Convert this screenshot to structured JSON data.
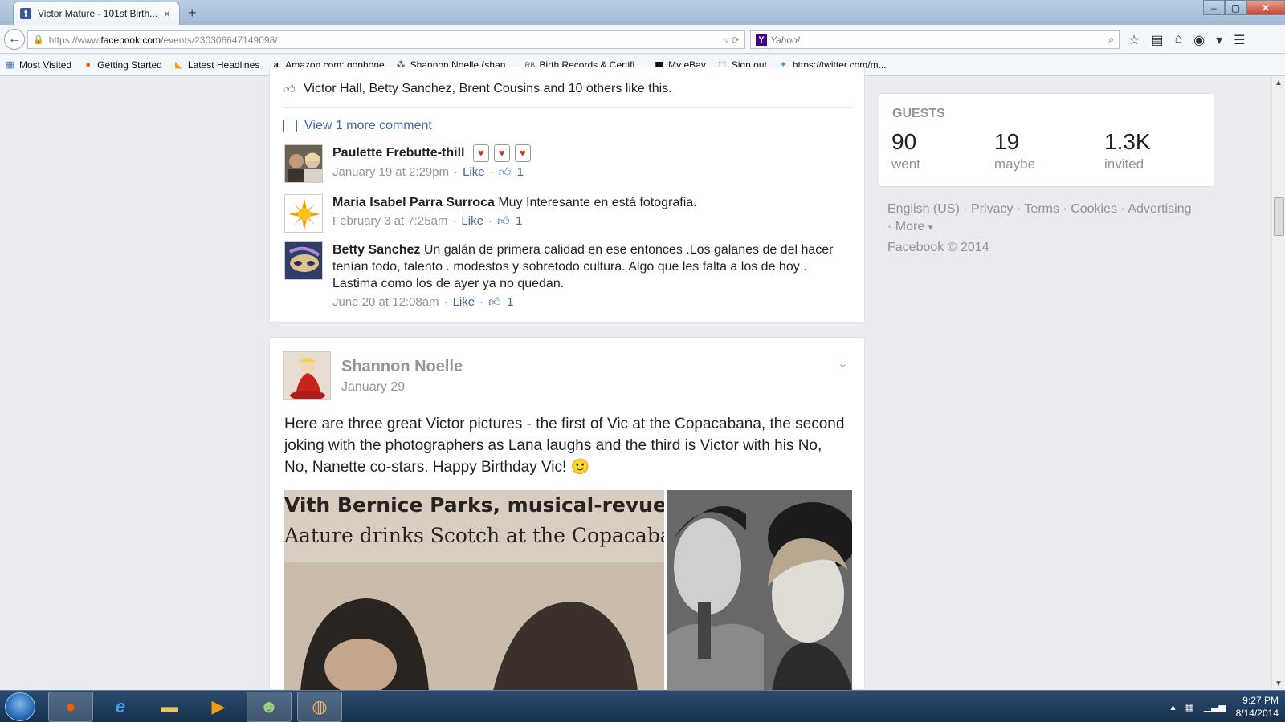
{
  "browser": {
    "tab_title": "Victor Mature - 101st Birth...",
    "tab_close": "×",
    "new_tab": "+",
    "url_prefix": "https://www.",
    "url_domain": "facebook.com",
    "url_path": "/events/230306647149098/",
    "search_placeholder": "Yahoo!",
    "window_min": "–",
    "window_max": "▢",
    "window_close": "✕"
  },
  "bookmarks": [
    {
      "label": "Most Visited",
      "icon": "most-visited-icon"
    },
    {
      "label": "Getting Started",
      "icon": "firefox-icon"
    },
    {
      "label": "Latest Headlines",
      "icon": "rss-icon"
    },
    {
      "label": "Amazon.com: gophone",
      "icon": "amazon-icon"
    },
    {
      "label": "Shannon Noelle (shan...",
      "icon": "people-icon"
    },
    {
      "label": "Birth Records & Certifi...",
      "icon": "rb-icon"
    },
    {
      "label": "My eBay",
      "icon": "ebay-icon"
    },
    {
      "label": "Sign out",
      "icon": "page-icon"
    },
    {
      "label": "https://twitter.com/m...",
      "icon": "twitter-icon"
    }
  ],
  "post1": {
    "likes_text": "Victor Hall, Betty Sanchez, Brent Cousins and 10 others like this.",
    "view_more": "View 1 more comment",
    "comments": [
      {
        "name": "Paulette Frebutte-thill",
        "text": "",
        "date": "January 19 at 2:29pm",
        "like": "Like",
        "likes": "1"
      },
      {
        "name": "Maria Isabel Parra Surroca",
        "text": "Muy Interesante en está fotografia.",
        "date": "February 3 at 7:25am",
        "like": "Like",
        "likes": "1"
      },
      {
        "name": "Betty Sanchez",
        "text": "Un galán de primera calidad en ese entonces .Los galanes de del hacer tenían todo, talento . modestos y sobretodo cultura. Algo que les falta a los de hoy . Lastima como los de ayer ya no quedan.",
        "date": "June 20 at 12:08am",
        "like": "Like",
        "likes": "1"
      }
    ]
  },
  "guests": {
    "heading": "GUESTS",
    "went_count": "90",
    "went_label": "went",
    "maybe_count": "19",
    "maybe_label": "maybe",
    "invited_count": "1.3K",
    "invited_label": "invited"
  },
  "footer": {
    "links": [
      "English (US)",
      "Privacy",
      "Terms",
      "Cookies",
      "Advertising"
    ],
    "more": "More",
    "copyright": "Facebook © 2014"
  },
  "post2": {
    "author": "Shannon Noelle",
    "date": "January 29",
    "text": "Here are three great Victor pictures - the first of Vic at the Copacabana, the second joking with the photographers as Lana laughs and the third is Victor with his No, No, Nanette co-stars. Happy Birthday Vic! 🙂",
    "image1_line1": "Vith Bernice Parks, musical-revue st",
    "image1_line2": "Aature drinks Scotch at the Copacaba"
  },
  "taskbar": {
    "time": "9:27 PM",
    "date": "8/14/2014"
  }
}
